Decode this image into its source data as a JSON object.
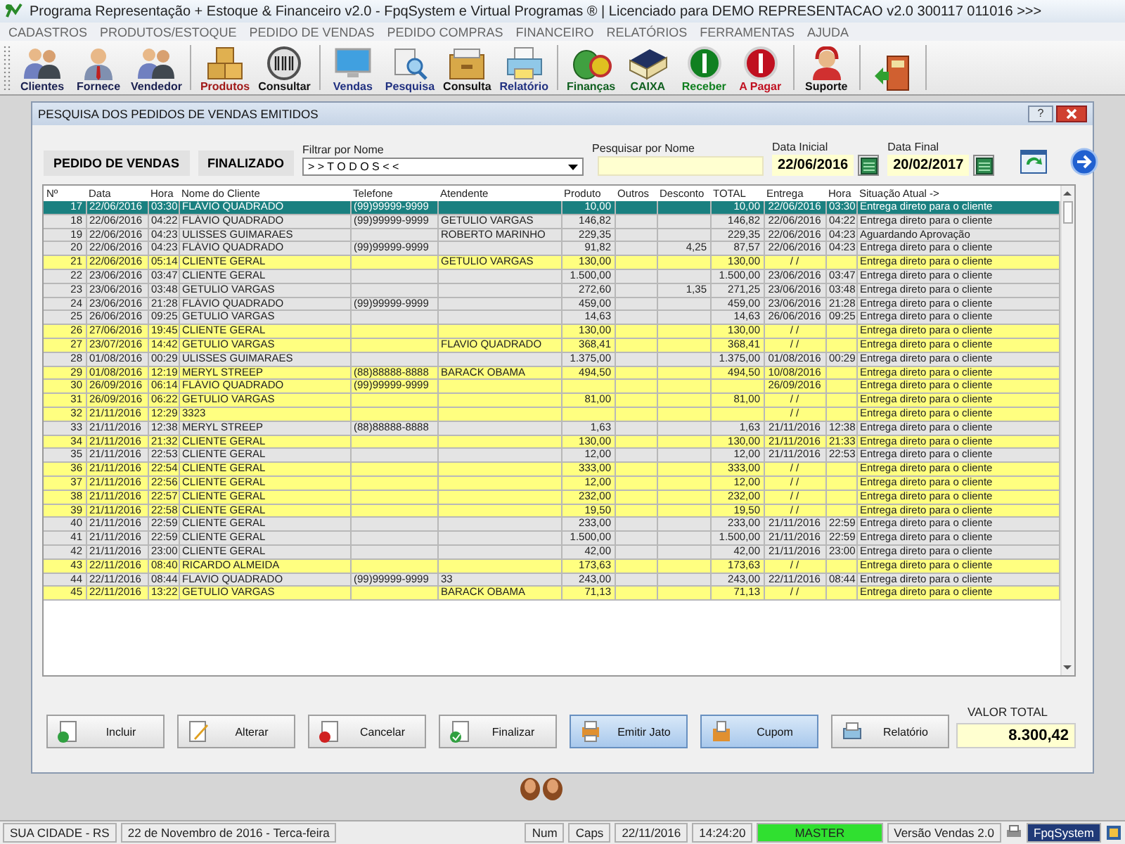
{
  "window": {
    "title": "Programa Representação + Estoque & Financeiro v2.0 - FpqSystem e Virtual Programas ® | Licenciado para  DEMO REPRESENTACAO v2.0 300117 011016 >>>"
  },
  "menu": [
    "CADASTROS",
    "PRODUTOS/ESTOQUE",
    "PEDIDO DE VENDAS",
    "PEDIDO COMPRAS",
    "FINANCEIRO",
    "RELATÓRIOS",
    "FERRAMENTAS",
    "AJUDA"
  ],
  "toolbar": [
    [
      {
        "label": "Clientes",
        "kind": "people",
        "color": "#1a2050"
      },
      {
        "label": "Fornece",
        "kind": "person",
        "color": "#1a2050"
      },
      {
        "label": "Vendedor",
        "kind": "people",
        "color": "#1a2050"
      }
    ],
    [
      {
        "label": "Produtos",
        "kind": "boxes",
        "color": "#a01818"
      },
      {
        "label": "Consultar",
        "kind": "barcode",
        "color": "#101010"
      }
    ],
    [
      {
        "label": "Vendas",
        "kind": "monitor",
        "color": "#203080"
      },
      {
        "label": "Pesquisa",
        "kind": "search",
        "color": "#203080"
      },
      {
        "label": "Consulta",
        "kind": "drawer",
        "color": "#101010"
      },
      {
        "label": "Relatório",
        "kind": "printer",
        "color": "#203080"
      }
    ],
    [
      {
        "label": "Finanças",
        "kind": "money",
        "color": "#106020"
      },
      {
        "label": "CAIXA",
        "kind": "book",
        "color": "#106020"
      },
      {
        "label": "Receber",
        "kind": "coin",
        "color": "#108020"
      },
      {
        "label": "A Pagar",
        "kind": "coin",
        "color": "#c01020"
      }
    ],
    [
      {
        "label": "Suporte",
        "kind": "headset",
        "color": "#101010"
      }
    ],
    [
      {
        "kind": "exit"
      }
    ]
  ],
  "dialog": {
    "title": "PESQUISA DOS PEDIDOS DE VENDAS EMITIDOS",
    "help": "?",
    "order_type": "PEDIDO DE VENDAS",
    "status": "FINALIZADO",
    "filter": {
      "label": "Filtrar por Nome",
      "value": "> > T O D O S < <"
    },
    "search": {
      "label": "Pesquisar por Nome"
    },
    "start_date": {
      "label": "Data Inicial",
      "value": "22/06/2016"
    },
    "end_date": {
      "label": "Data Final",
      "value": "20/02/2017"
    },
    "table": {
      "columns": [
        "Nº",
        "Data",
        "Hora",
        "Nome do Cliente",
        "Telefone",
        "Atendente",
        "Produto",
        "Outros",
        "Desconto",
        "TOTAL",
        "Entrega",
        "Hora",
        "Situação Atual ->"
      ],
      "rows": [
        {
          "selected": true,
          "cells": [
            "17",
            "22/06/2016",
            "03:30",
            "FLÁVIO QUADRADO",
            "(99)99999-9999",
            null,
            "10,00",
            null,
            null,
            "10,00",
            "22/06/2016",
            "03:30",
            "Entrega direto para o cliente"
          ]
        },
        {
          "selected": false,
          "color": "#e4e4e4",
          "cells": [
            "18",
            "22/06/2016",
            "04:22",
            "FLÁVIO QUADRADO",
            "(99)99999-9999",
            "GETULIO VARGAS",
            "146,82",
            null,
            null,
            "146,82",
            "22/06/2016",
            "04:22",
            "Entrega direto para o cliente"
          ]
        },
        {
          "selected": false,
          "color": "#e4e4e4",
          "cells": [
            "19",
            "22/06/2016",
            "04:23",
            "ULISSES GUIMARAES",
            null,
            "ROBERTO MARINHO",
            "229,35",
            null,
            null,
            "229,35",
            "22/06/2016",
            "04:23",
            "Aguardando Aprovação"
          ]
        },
        {
          "selected": false,
          "color": "#e4e4e4",
          "cells": [
            "20",
            "22/06/2016",
            "04:23",
            "FLÁVIO QUADRADO",
            "(99)99999-9999",
            null,
            "91,82",
            null,
            "4,25",
            "87,57",
            "22/06/2016",
            "04:23",
            "Entrega direto para o cliente"
          ]
        },
        {
          "selected": false,
          "color": "#ffff80",
          "cells": [
            "21",
            "22/06/2016",
            "05:14",
            "CLIENTE GERAL",
            null,
            "GETULIO VARGAS",
            "130,00",
            null,
            null,
            "130,00",
            "/ /",
            null,
            "Entrega direto para o cliente"
          ]
        },
        {
          "selected": false,
          "color": "#e4e4e4",
          "cells": [
            "22",
            "23/06/2016",
            "03:47",
            "CLIENTE GERAL",
            null,
            null,
            "1.500,00",
            null,
            null,
            "1.500,00",
            "23/06/2016",
            "03:47",
            "Entrega direto para o cliente"
          ]
        },
        {
          "selected": false,
          "color": "#e4e4e4",
          "cells": [
            "23",
            "23/06/2016",
            "03:48",
            "GETULIO VARGAS",
            null,
            null,
            "272,60",
            null,
            "1,35",
            "271,25",
            "23/06/2016",
            "03:48",
            "Entrega direto para o cliente"
          ]
        },
        {
          "selected": false,
          "color": "#e4e4e4",
          "cells": [
            "24",
            "23/06/2016",
            "21:28",
            "FLÁVIO QUADRADO",
            "(99)99999-9999",
            null,
            "459,00",
            null,
            null,
            "459,00",
            "23/06/2016",
            "21:28",
            "Entrega direto para o cliente"
          ]
        },
        {
          "selected": false,
          "color": "#e4e4e4",
          "cells": [
            "25",
            "26/06/2016",
            "09:25",
            "GETULIO VARGAS",
            null,
            null,
            "14,63",
            null,
            null,
            "14,63",
            "26/06/2016",
            "09:25",
            "Entrega direto para o cliente"
          ]
        },
        {
          "selected": false,
          "color": "#ffff80",
          "cells": [
            "26",
            "27/06/2016",
            "19:45",
            "CLIENTE GERAL",
            null,
            null,
            "130,00",
            null,
            null,
            "130,00",
            "/ /",
            null,
            "Entrega direto para o cliente"
          ]
        },
        {
          "selected": false,
          "color": "#ffff80",
          "cells": [
            "27",
            "23/07/2016",
            "14:42",
            "GETULIO VARGAS",
            null,
            "FLAVIO QUADRADO",
            "368,41",
            null,
            null,
            "368,41",
            "/ /",
            null,
            "Entrega direto para o cliente"
          ]
        },
        {
          "selected": false,
          "color": "#e4e4e4",
          "cells": [
            "28",
            "01/08/2016",
            "00:29",
            "ULISSES GUIMARAES",
            null,
            null,
            "1.375,00",
            null,
            null,
            "1.375,00",
            "01/08/2016",
            "00:29",
            "Entrega direto para o cliente"
          ]
        },
        {
          "selected": false,
          "color": "#ffff80",
          "cells": [
            "29",
            "01/08/2016",
            "12:19",
            "MERYL STREEP",
            "(88)88888-8888",
            "BARACK OBAMA",
            "494,50",
            null,
            null,
            "494,50",
            "10/08/2016",
            null,
            "Entrega direto para o cliente"
          ]
        },
        {
          "selected": false,
          "color": "#ffff80",
          "cells": [
            "30",
            "26/09/2016",
            "06:14",
            "FLÁVIO QUADRADO",
            "(99)99999-9999",
            null,
            null,
            null,
            null,
            null,
            "26/09/2016",
            null,
            "Entrega direto para o cliente"
          ]
        },
        {
          "selected": false,
          "color": "#ffff80",
          "cells": [
            "31",
            "26/09/2016",
            "06:22",
            "GETULIO VARGAS",
            null,
            null,
            "81,00",
            null,
            null,
            "81,00",
            "/ /",
            null,
            "Entrega direto para o cliente"
          ]
        },
        {
          "selected": false,
          "color": "#ffff80",
          "cells": [
            "32",
            "21/11/2016",
            "12:29",
            "3323",
            null,
            null,
            null,
            null,
            null,
            null,
            "/ /",
            null,
            "Entrega direto para o cliente"
          ]
        },
        {
          "selected": false,
          "color": "#e4e4e4",
          "cells": [
            "33",
            "21/11/2016",
            "12:38",
            "MERYL STREEP",
            "(88)88888-8888",
            null,
            "1,63",
            null,
            null,
            "1,63",
            "21/11/2016",
            "12:38",
            "Entrega direto para o cliente"
          ]
        },
        {
          "selected": false,
          "color": "#ffff80",
          "cells": [
            "34",
            "21/11/2016",
            "21:32",
            "CLIENTE GERAL",
            null,
            null,
            "130,00",
            null,
            null,
            "130,00",
            "21/11/2016",
            "21:33",
            "Entrega direto para o cliente"
          ]
        },
        {
          "selected": false,
          "color": "#e4e4e4",
          "cells": [
            "35",
            "21/11/2016",
            "22:53",
            "CLIENTE GERAL",
            null,
            null,
            "12,00",
            null,
            null,
            "12,00",
            "21/11/2016",
            "22:53",
            "Entrega direto para o cliente"
          ]
        },
        {
          "selected": false,
          "color": "#ffff80",
          "cells": [
            "36",
            "21/11/2016",
            "22:54",
            "CLIENTE GERAL",
            null,
            null,
            "333,00",
            null,
            null,
            "333,00",
            "/ /",
            null,
            "Entrega direto para o cliente"
          ]
        },
        {
          "selected": false,
          "color": "#ffff80",
          "cells": [
            "37",
            "21/11/2016",
            "22:56",
            "CLIENTE GERAL",
            null,
            null,
            "12,00",
            null,
            null,
            "12,00",
            "/ /",
            null,
            "Entrega direto para o cliente"
          ]
        },
        {
          "selected": false,
          "color": "#ffff80",
          "cells": [
            "38",
            "21/11/2016",
            "22:57",
            "CLIENTE GERAL",
            null,
            null,
            "232,00",
            null,
            null,
            "232,00",
            "/ /",
            null,
            "Entrega direto para o cliente"
          ]
        },
        {
          "selected": false,
          "color": "#ffff80",
          "cells": [
            "39",
            "21/11/2016",
            "22:58",
            "CLIENTE GERAL",
            null,
            null,
            "19,50",
            null,
            null,
            "19,50",
            "/ /",
            null,
            "Entrega direto para o cliente"
          ]
        },
        {
          "selected": false,
          "color": "#e4e4e4",
          "cells": [
            "40",
            "21/11/2016",
            "22:59",
            "CLIENTE GERAL",
            null,
            null,
            "233,00",
            null,
            null,
            "233,00",
            "21/11/2016",
            "22:59",
            "Entrega direto para o cliente"
          ]
        },
        {
          "selected": false,
          "color": "#e4e4e4",
          "cells": [
            "41",
            "21/11/2016",
            "22:59",
            "CLIENTE GERAL",
            null,
            null,
            "1.500,00",
            null,
            null,
            "1.500,00",
            "21/11/2016",
            "22:59",
            "Entrega direto para o cliente"
          ]
        },
        {
          "selected": false,
          "color": "#e4e4e4",
          "cells": [
            "42",
            "21/11/2016",
            "23:00",
            "CLIENTE GERAL",
            null,
            null,
            "42,00",
            null,
            null,
            "42,00",
            "21/11/2016",
            "23:00",
            "Entrega direto para o cliente"
          ]
        },
        {
          "selected": false,
          "color": "#ffff80",
          "cells": [
            "43",
            "22/11/2016",
            "08:40",
            "RICARDO ALMEIDA",
            null,
            null,
            "173,63",
            null,
            null,
            "173,63",
            "/ /",
            null,
            "Entrega direto para o cliente"
          ]
        },
        {
          "selected": false,
          "color": "#e4e4e4",
          "cells": [
            "44",
            "22/11/2016",
            "08:44",
            "FLAVIO QUADRADO",
            "(99)99999-9999",
            "33",
            "243,00",
            null,
            null,
            "243,00",
            "22/11/2016",
            "08:44",
            "Entrega direto para o cliente"
          ]
        },
        {
          "selected": false,
          "color": "#ffff80",
          "cells": [
            "45",
            "22/11/2016",
            "13:22",
            "GETULIO VARGAS",
            null,
            "BARACK OBAMA",
            "71,13",
            null,
            null,
            "71,13",
            "/ /",
            null,
            "Entrega direto para o cliente"
          ]
        }
      ]
    },
    "buttons": [
      {
        "label": "Incluir",
        "kind": "add"
      },
      {
        "label": "Alterar",
        "kind": "edit"
      },
      {
        "label": "Cancelar",
        "kind": "cancel"
      },
      {
        "label": "Finalizar",
        "kind": "finish"
      },
      {
        "label": "Emitir Jato",
        "kind": "inkjet"
      },
      {
        "label": "Cupom",
        "kind": "receipt"
      },
      {
        "label": "Relatório",
        "kind": "report"
      }
    ],
    "total": {
      "label": "VALOR TOTAL",
      "value": "8.300,42"
    }
  },
  "status_bar": {
    "city": "SUA CIDADE - RS",
    "date_text": "22 de Novembro de 2016 - Terca-feira",
    "num": "Num",
    "caps": "Caps",
    "date": "22/11/2016",
    "time": "14:24:20",
    "user": "MASTER",
    "version": "Versão Vendas 2.0",
    "brand": "FpqSystem"
  }
}
